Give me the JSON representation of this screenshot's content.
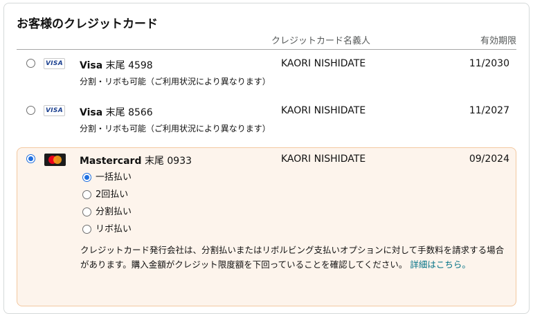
{
  "section": {
    "title": "お客様のクレジットカード",
    "col_holder": "クレジットカード名義人",
    "col_expiry": "有効期限"
  },
  "cards": [
    {
      "logo": "visa-logo",
      "logo_text": "VISA",
      "brand": "Visa",
      "suffix": "末尾 4598",
      "holder": "KAORI NISHIDATE",
      "expiry": "11/2030",
      "note": "分割・リボも可能（ご利用状況により異なります）",
      "selected": false
    },
    {
      "logo": "visa-logo",
      "logo_text": "VISA",
      "brand": "Visa",
      "suffix": "末尾 8566",
      "holder": "KAORI NISHIDATE",
      "expiry": "11/2027",
      "note": "分割・リボも可能（ご利用状況により異なります）",
      "selected": false
    },
    {
      "logo": "mastercard-logo",
      "brand": "Mastercard",
      "suffix": "末尾 0933",
      "holder": "KAORI NISHIDATE",
      "expiry": "09/2024",
      "selected": true
    }
  ],
  "payment_options": [
    {
      "label": "一括払い",
      "selected": true
    },
    {
      "label": "2回払い",
      "selected": false
    },
    {
      "label": "分割払い",
      "selected": false
    },
    {
      "label": "リボ払い",
      "selected": false
    }
  ],
  "disclaimer": {
    "text": "クレジットカード発行会社は、分割払いまたはリボルビング支払いオプションに対して手数料を請求する場合があります。購入金額がクレジット限度額を下回っていることを確認してください。",
    "link": "詳細はこちら。"
  },
  "colors": {
    "selected_bg": "#fdf4ec",
    "selected_border": "#f3c8a0",
    "radio_selected": "#1f6fe0",
    "link": "#007185"
  }
}
